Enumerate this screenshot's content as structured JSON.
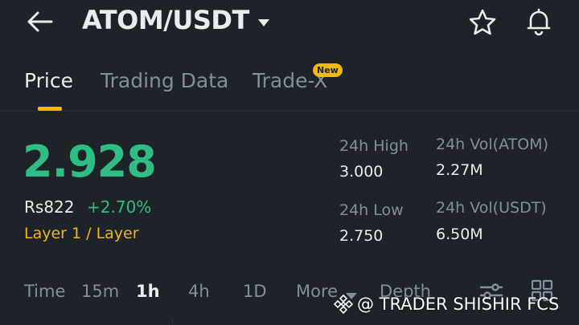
{
  "header": {
    "title": "ATOM/USDT"
  },
  "tabs": [
    {
      "label": "Price",
      "active": true
    },
    {
      "label": "Trading Data",
      "active": false
    },
    {
      "label": "Trade-X",
      "active": false,
      "badge": "New"
    }
  ],
  "price": {
    "last": "2.928",
    "fiat": "Rs822",
    "change": "+2.70%",
    "tag": "Layer 1 / Layer"
  },
  "stats": {
    "high_label": "24h High",
    "high_value": "3.000",
    "low_label": "24h Low",
    "low_value": "2.750",
    "vol_base_label": "24h Vol(ATOM)",
    "vol_base_value": "2.27M",
    "vol_quote_label": "24h Vol(USDT)",
    "vol_quote_value": "6.50M"
  },
  "timeframes": {
    "label": "Time",
    "items": [
      "15m",
      "1h",
      "4h",
      "1D"
    ],
    "active": "1h",
    "more": "More",
    "depth": "Depth"
  },
  "watermark": {
    "text": "@ TRADER SHISHIR FCS"
  },
  "colors": {
    "background": "#1e2329",
    "up": "#2ebd85",
    "accent": "#f0b90b",
    "muted": "#848e9c",
    "text": "#eaecef"
  },
  "icons": [
    "back-arrow-icon",
    "dropdown-caret-icon",
    "star-icon",
    "bell-icon",
    "chart-settings-icon",
    "grid-icon"
  ]
}
